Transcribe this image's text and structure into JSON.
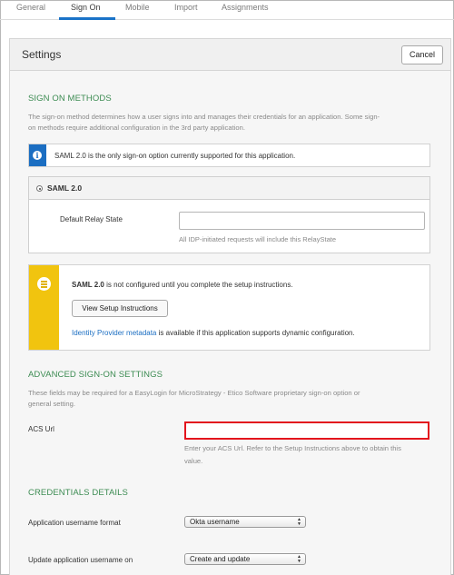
{
  "tabs": [
    {
      "label": "General"
    },
    {
      "label": "Sign On"
    },
    {
      "label": "Mobile"
    },
    {
      "label": "Import"
    },
    {
      "label": "Assignments"
    }
  ],
  "active_tab": "Sign On",
  "settings": {
    "title": "Settings",
    "cancel_label": "Cancel"
  },
  "sign_on_methods": {
    "title": "SIGN ON METHODS",
    "description_line1": "The sign-on method determines how a user signs into and manages their credentials for an application. Some sign-",
    "description_line2": "on methods require additional configuration in the 3rd party application.",
    "info_text": "SAML 2.0 is the only sign-on option currently supported for this application.",
    "saml_option_label": "SAML 2.0",
    "relay_state_label": "Default Relay State",
    "relay_state_value": "",
    "relay_state_help": "All IDP-initiated requests will include this RelayState"
  },
  "warning": {
    "saml_bold": "SAML 2.0",
    "saml_rest": " is not configured until you complete the setup instructions.",
    "setup_button_label": "View Setup Instructions",
    "idp_link_label": "Identity Provider metadata",
    "idp_rest": " is available if this application supports dynamic configuration."
  },
  "advanced": {
    "title": "ADVANCED SIGN-ON SETTINGS",
    "description_line1": "These fields may be required for a EasyLogin for MicroStrategy - Etico Software proprietary sign-on option or",
    "description_line2": "general setting.",
    "acs_label": "ACS Url",
    "acs_value": "",
    "acs_help_line1": "Enter your ACS Url. Refer to the Setup Instructions above to obtain this",
    "acs_help_line2": "value."
  },
  "credentials": {
    "title": "CREDENTIALS DETAILS",
    "username_format_label": "Application username format",
    "username_format_value": "Okta username",
    "update_on_label": "Update application username on",
    "update_on_value": "Create and update"
  },
  "colors": {
    "accent": "#1a73c8",
    "section_title": "#3d8c53",
    "info_icon_bg": "#1b6ec2",
    "warning_bg": "#f1c40f",
    "highlight_border": "#e3141d"
  }
}
